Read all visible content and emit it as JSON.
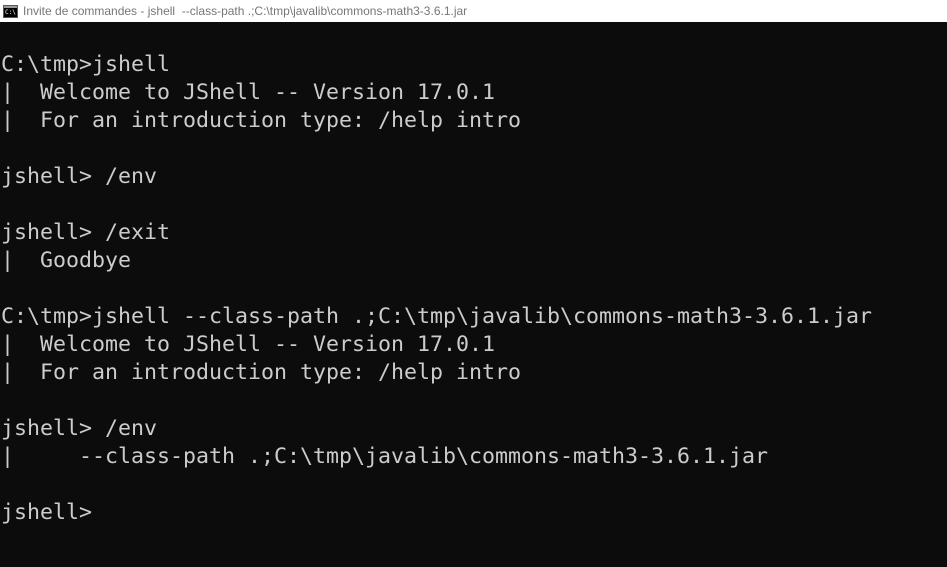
{
  "window": {
    "title": "Invite de commandes - jshell  --class-path .;C:\\tmp\\javalib\\commons-math3-3.6.1.jar",
    "icon": "cmd-icon",
    "icon_prompt": "C:\\"
  },
  "console": {
    "lines": [
      "C:\\tmp>jshell",
      "|  Welcome to JShell -- Version 17.0.1",
      "|  For an introduction type: /help intro",
      "",
      "jshell> /env",
      "",
      "jshell> /exit",
      "|  Goodbye",
      "",
      "C:\\tmp>jshell --class-path .;C:\\tmp\\javalib\\commons-math3-3.6.1.jar",
      "|  Welcome to JShell -- Version 17.0.1",
      "|  For an introduction type: /help intro",
      "",
      "jshell> /env",
      "|     --class-path .;C:\\tmp\\javalib\\commons-math3-3.6.1.jar",
      "",
      "jshell>"
    ]
  },
  "colors": {
    "background": "#0c0c0c",
    "text": "#cccccc",
    "titlebar": "#ffffff",
    "title_text": "#767676"
  }
}
